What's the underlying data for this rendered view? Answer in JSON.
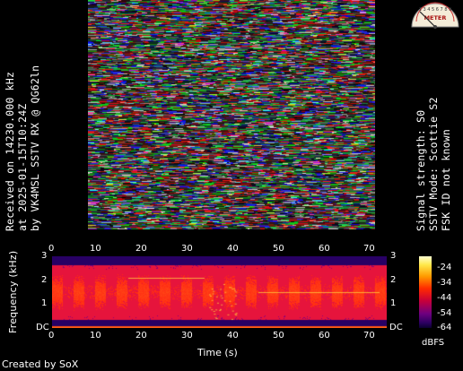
{
  "caption_left": {
    "line1": "Received on  14230.000 kHz",
    "line2": "at 2025-01-15T10:24Z",
    "line3": "by VK4MSL SSTV RX @ QG62ln"
  },
  "caption_right": {
    "line1": "Signal strength: S0",
    "line2": "SSTV Mode: Scottie S2",
    "line3": "FSK ID not known"
  },
  "meter": {
    "label": "METER",
    "scale_text": "1 3 4 5 6 7 8 9"
  },
  "spectrogram": {
    "x_ticks": [
      "0",
      "10",
      "20",
      "30",
      "40",
      "50",
      "60",
      "70"
    ],
    "y_ticks": [
      "3",
      "2",
      "1",
      "DC"
    ],
    "x_label": "Time (s)",
    "y_label": "Frequency (kHz)",
    "colorbar_ticks": [
      "-24",
      "-34",
      "-44",
      "-54",
      "-64"
    ],
    "colorbar_label": "dBFS"
  },
  "credit": "Created by SoX",
  "colors": {
    "background": "#000000",
    "spectrogram_base": "#1a0058",
    "signal_band": "#ff2a2a"
  }
}
